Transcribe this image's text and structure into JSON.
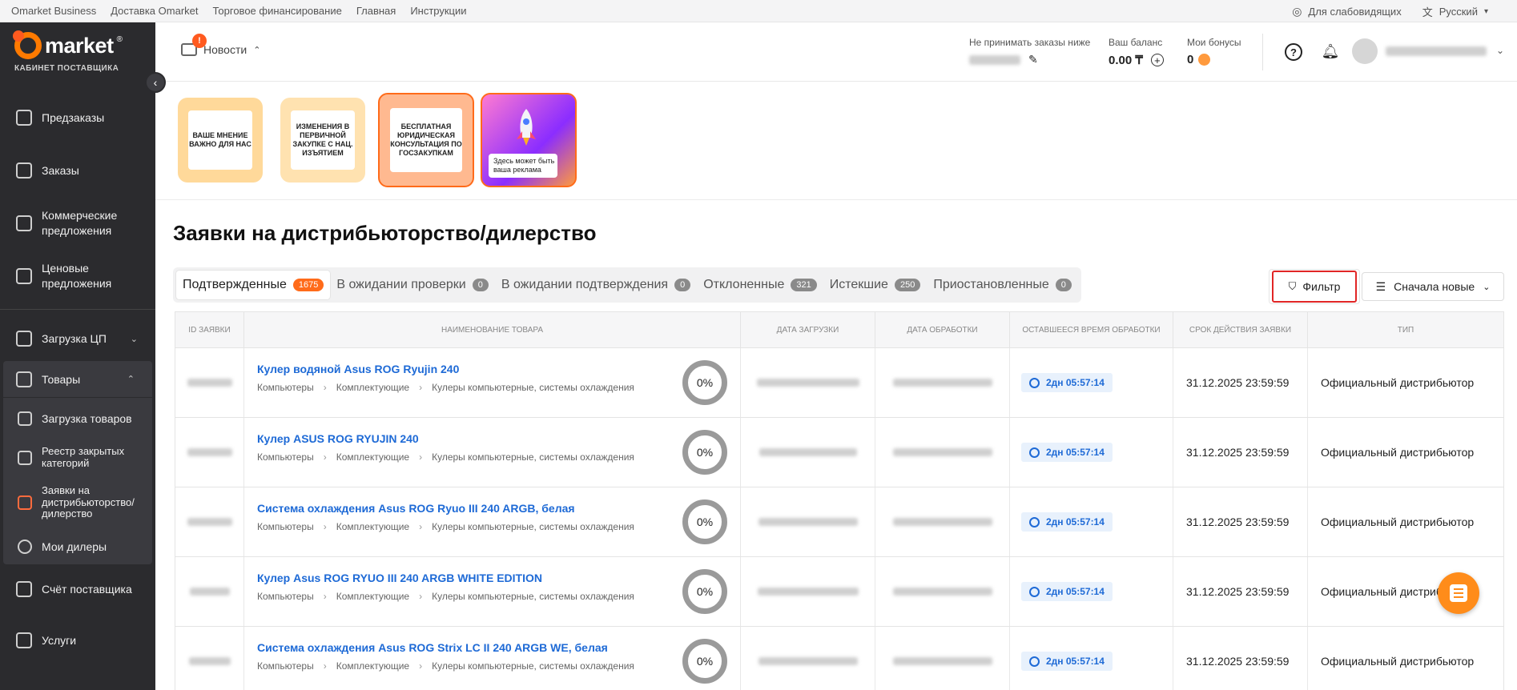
{
  "topbar": {
    "links": [
      "Omarket Business",
      "Доставка Omarket",
      "Торговое финансирование",
      "Главная",
      "Инструкции"
    ],
    "accessibility": "Для слабовидящих",
    "language": "Русский"
  },
  "sidebar": {
    "logo": "market",
    "cabinet": "КАБИНЕТ ПОСТАВЩИКА",
    "items": [
      {
        "label": "Предзаказы"
      },
      {
        "label": "Заказы"
      },
      {
        "label": "Коммерческие предложения"
      },
      {
        "label": "Ценовые предложения"
      },
      {
        "label": "Загрузка ЦП"
      },
      {
        "label": "Товары"
      }
    ],
    "subitems": [
      {
        "label": "Загрузка товаров"
      },
      {
        "label": "Реестр закрытых категорий"
      },
      {
        "label": "Заявки на дистрибьюторство/ дилерство"
      },
      {
        "label": "Мои дилеры"
      }
    ],
    "bottom": [
      {
        "label": "Счёт поставщика"
      },
      {
        "label": "Услуги"
      }
    ]
  },
  "header": {
    "news_label": "Новости",
    "news_badge": "!",
    "no_orders_label": "Не принимать заказы ниже",
    "balance_label": "Ваш баланс",
    "balance_value": "0.00 ₸",
    "bonus_label": "Мои бонусы",
    "bonus_value": "0"
  },
  "banners": [
    {
      "text": "ВАШЕ МНЕНИЕ ВАЖНО ДЛЯ НАС",
      "bg": "#ffd99a"
    },
    {
      "text": "ИЗМЕНЕНИЯ В ПЕРВИЧНОЙ ЗАКУПКЕ С НАЦ. ИЗЪЯТИЕМ",
      "bg": "#ffe2b0"
    },
    {
      "text": "БЕСПЛАТНАЯ ЮРИДИЧЕСКАЯ КОНСУЛЬТАЦИЯ ПО ГОСЗАКУПКАМ",
      "bg": "#ffb990"
    },
    {
      "text": "Здесь может быть ваша реклама",
      "bg": "#a23bff"
    }
  ],
  "page": {
    "title": "Заявки на дистрибьюторство/дилерство",
    "filter_label": "Фильтр",
    "sort_label": "Сначала новые"
  },
  "tabs": [
    {
      "label": "Подтвержденные",
      "count": "1675"
    },
    {
      "label": "В ожидании проверки",
      "count": "0"
    },
    {
      "label": "В ожидании подтверждения",
      "count": "0"
    },
    {
      "label": "Отклоненные",
      "count": "321"
    },
    {
      "label": "Истекшие",
      "count": "250"
    },
    {
      "label": "Приостановленные",
      "count": "0"
    }
  ],
  "table": {
    "columns": [
      "ID ЗАЯВКИ",
      "НАИМЕНОВАНИЕ ТОВАРА",
      "ДАТА ЗАГРУЗКИ",
      "ДАТА ОБРАБОТКИ",
      "ОСТАВШЕЕСЯ ВРЕМЯ ОБРАБОТКИ",
      "СРОК ДЕЙСТВИЯ ЗАЯВКИ",
      "ТИП"
    ],
    "rows": [
      {
        "name": "Кулер водяной Asus ROG Ryujin 240",
        "crumbs": [
          "Компьютеры",
          "Комплектующие",
          "Кулеры компьютерные, системы охлаждения"
        ],
        "progress": "0%",
        "remaining": "2дн 05:57:14",
        "expiry": "31.12.2025 23:59:59",
        "type": "Официальный дистрибьютор"
      },
      {
        "name": "Кулер ASUS ROG RYUJIN 240",
        "crumbs": [
          "Компьютеры",
          "Комплектующие",
          "Кулеры компьютерные, системы охлаждения"
        ],
        "progress": "0%",
        "remaining": "2дн 05:57:14",
        "expiry": "31.12.2025 23:59:59",
        "type": "Официальный дистрибьютор"
      },
      {
        "name": "Система охлаждения Asus ROG Ryuo III 240 ARGB, белая",
        "crumbs": [
          "Компьютеры",
          "Комплектующие",
          "Кулеры компьютерные, системы охлаждения"
        ],
        "progress": "0%",
        "remaining": "2дн 05:57:14",
        "expiry": "31.12.2025 23:59:59",
        "type": "Официальный дистрибьютор"
      },
      {
        "name": "Кулер Asus ROG RYUO III 240 ARGB WHITE EDITION",
        "crumbs": [
          "Компьютеры",
          "Комплектующие",
          "Кулеры компьютерные, системы охлаждения"
        ],
        "progress": "0%",
        "remaining": "2дн 05:57:14",
        "expiry": "31.12.2025 23:59:59",
        "type": "Официальный дистрибьютор"
      },
      {
        "name": "Система охлаждения Asus ROG Strix LC II 240 ARGB WE, белая",
        "crumbs": [
          "Компьютеры",
          "Комплектующие",
          "Кулеры компьютерные, системы охлаждения"
        ],
        "progress": "0%",
        "remaining": "2дн 05:57:14",
        "expiry": "31.12.2025 23:59:59",
        "type": "Официальный дистрибьютор"
      }
    ]
  }
}
